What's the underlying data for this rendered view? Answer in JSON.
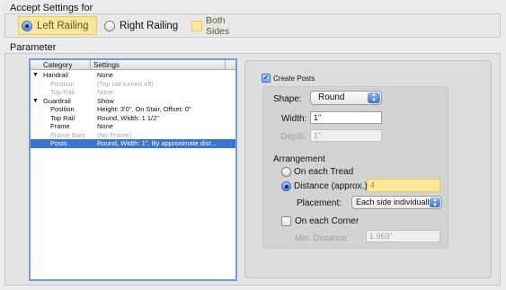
{
  "accept": {
    "title": "Accept Settings for",
    "options": [
      {
        "label": "Left Railing",
        "selected": true
      },
      {
        "label": "Right Railing",
        "selected": false
      },
      {
        "label": "Both Sides",
        "selected": false
      }
    ]
  },
  "parameter": {
    "title": "Parameter",
    "table": {
      "headers": [
        "Category",
        "Settings"
      ],
      "rows": [
        {
          "category": "Handrail",
          "setting": "None",
          "level": 0,
          "expanded": true,
          "dim": false,
          "selected": false
        },
        {
          "category": "Position",
          "setting": "(Top rail turned off)",
          "level": 1,
          "dim": true,
          "selected": false
        },
        {
          "category": "Top Rail",
          "setting": "None",
          "level": 1,
          "dim": true,
          "selected": false
        },
        {
          "category": "Guardrail",
          "setting": "Show",
          "level": 0,
          "expanded": true,
          "dim": false,
          "selected": false
        },
        {
          "category": "Position",
          "setting": "Height: 3'0\", On Stair, Offset: 0\"",
          "level": 1,
          "dim": false,
          "selected": false
        },
        {
          "category": "Top Rail",
          "setting": "Round, Width: 1 1/2\"",
          "level": 1,
          "dim": false,
          "selected": false
        },
        {
          "category": "Frame",
          "setting": "None",
          "level": 1,
          "dim": false,
          "selected": false
        },
        {
          "category": "Frame Bars",
          "setting": "(No Frame)",
          "level": 1,
          "dim": true,
          "selected": false
        },
        {
          "category": "Posts",
          "setting": "Round, Width: 1\", By approximate dist...",
          "level": 1,
          "dim": false,
          "selected": true
        }
      ]
    }
  },
  "posts": {
    "create_posts_label": "Create Posts",
    "create_posts_checked": true,
    "shape_label": "Shape:",
    "shape_value": "Round",
    "width_label": "Width:",
    "width_value": "1\"",
    "depth_label": "Depth:",
    "depth_value": "1\"",
    "arrangement_label": "Arrangement",
    "on_each_tread_label": "On each Tread",
    "distance_label": "Distance (approx.):",
    "distance_value": "4",
    "placement_label": "Placement:",
    "placement_value": "Each side individually",
    "on_each_corner_label": "On each Corner",
    "min_distance_label": "Min. Distance:",
    "min_distance_value": "1.969\""
  },
  "colors": {
    "highlight": "#fbe79a",
    "selection": "#3875d7",
    "focus_ring": "#6f9de0"
  }
}
